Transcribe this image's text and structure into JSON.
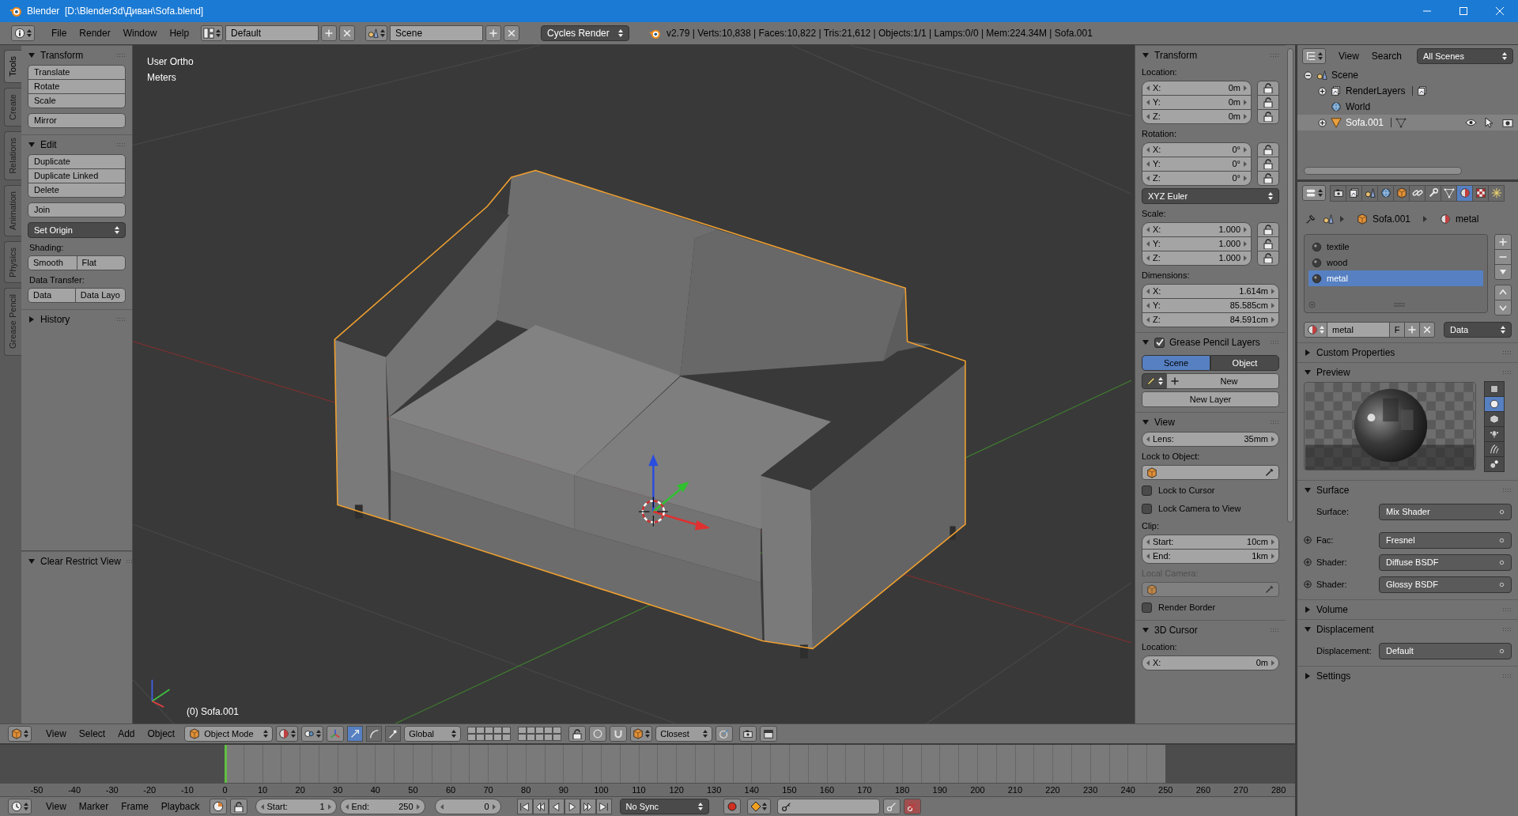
{
  "window": {
    "title": "Blender  [D:\\Blender3d\\Диван\\Sofa.blend]"
  },
  "info_header": {
    "menus": [
      "File",
      "Render",
      "Window",
      "Help"
    ],
    "layout": "Default",
    "scene": "Scene",
    "engine": "Cycles Render",
    "stats": "v2.79 | Verts:10,838 | Faces:10,822 | Tris:21,612 | Objects:1/1 | Lamps:0/0 | Mem:224.34M | Sofa.001"
  },
  "tool_tabs": [
    {
      "label": "Tools",
      "selected": true
    },
    {
      "label": "Create",
      "selected": false
    },
    {
      "label": "Relations",
      "selected": false
    },
    {
      "label": "Animation",
      "selected": false
    },
    {
      "label": "Physics",
      "selected": false
    },
    {
      "label": "Grease Pencil",
      "selected": false
    }
  ],
  "tool_shelf": [
    {
      "title": "Transform",
      "expanded": true,
      "items": [
        {
          "kind": "column",
          "labels": [
            "Translate",
            "Rotate",
            "Scale"
          ]
        },
        {
          "kind": "column",
          "labels": [
            "Mirror"
          ]
        }
      ]
    },
    {
      "title": "Edit",
      "expanded": true,
      "items": [
        {
          "kind": "column",
          "labels": [
            "Duplicate",
            "Duplicate Linked",
            "Delete"
          ]
        },
        {
          "kind": "column",
          "labels": [
            "Join"
          ]
        },
        {
          "kind": "dropdown",
          "text": "Set Origin"
        },
        {
          "kind": "label",
          "text": "Shading:"
        },
        {
          "kind": "row",
          "labels": [
            "Smooth",
            "Flat"
          ]
        },
        {
          "kind": "label",
          "text": "Data Transfer:"
        },
        {
          "kind": "row",
          "labels": [
            "Data",
            "Data Layo"
          ]
        }
      ]
    },
    {
      "title": "History",
      "expanded": false
    }
  ],
  "operator_panel": {
    "title": "Clear Restrict View",
    "expanded": true
  },
  "viewport": {
    "view_name": "User Ortho",
    "units": "Meters",
    "object_label": "(0) Sofa.001"
  },
  "properties_region": [
    {
      "title": "Transform",
      "expanded": true,
      "items": [
        {
          "kind": "label",
          "text": "Location:"
        },
        {
          "kind": "vector",
          "locks": true,
          "fields": [
            {
              "label": "X:",
              "value": "0m"
            },
            {
              "label": "Y:",
              "value": "0m"
            },
            {
              "label": "Z:",
              "value": "0m"
            }
          ]
        },
        {
          "kind": "label",
          "text": "Rotation:"
        },
        {
          "kind": "vector",
          "locks": true,
          "fields": [
            {
              "label": "X:",
              "value": "0°"
            },
            {
              "label": "Y:",
              "value": "0°"
            },
            {
              "label": "Z:",
              "value": "0°"
            }
          ]
        },
        {
          "kind": "dropdown",
          "text": "XYZ Euler"
        },
        {
          "kind": "label",
          "text": "Scale:"
        },
        {
          "kind": "vector",
          "locks": true,
          "fields": [
            {
              "label": "X:",
              "value": "1.000"
            },
            {
              "label": "Y:",
              "value": "1.000"
            },
            {
              "label": "Z:",
              "value": "1.000"
            }
          ]
        },
        {
          "kind": "label",
          "text": "Dimensions:"
        },
        {
          "kind": "vector",
          "locks": false,
          "fields": [
            {
              "label": "X:",
              "value": "1.614m"
            },
            {
              "label": "Y:",
              "value": "85.585cm"
            },
            {
              "label": "Z:",
              "value": "84.591cm"
            }
          ]
        }
      ]
    },
    {
      "title": "Grease Pencil Layers",
      "expanded": true,
      "checked": true,
      "items": [
        {
          "kind": "toggle",
          "options": [
            {
              "label": "Scene",
              "selected": true
            },
            {
              "label": "Object",
              "selected": false
            }
          ]
        },
        {
          "kind": "new",
          "text": "New"
        },
        {
          "kind": "button",
          "text": "New Layer"
        }
      ]
    },
    {
      "title": "View",
      "expanded": true,
      "items": [
        {
          "kind": "vector",
          "locks": false,
          "fields": [
            {
              "label": "Lens:",
              "value": "35mm"
            }
          ]
        },
        {
          "kind": "label",
          "text": "Lock to Object:"
        },
        {
          "kind": "object_field",
          "disabled": false
        },
        {
          "kind": "checkbox",
          "text": "Lock to Cursor",
          "checked": false
        },
        {
          "kind": "checkbox",
          "text": "Lock Camera to View",
          "checked": false
        },
        {
          "kind": "label",
          "text": "Clip:"
        },
        {
          "kind": "vector",
          "locks": false,
          "fields": [
            {
              "label": "Start:",
              "value": "10cm"
            },
            {
              "label": "End:",
              "value": "1km"
            }
          ]
        },
        {
          "kind": "label",
          "text": "Local Camera:",
          "disabled": true
        },
        {
          "kind": "object_field",
          "disabled": true
        },
        {
          "kind": "checkbox",
          "text": "Render Border",
          "checked": false
        }
      ]
    },
    {
      "title": "3D Cursor",
      "expanded": true,
      "items": [
        {
          "kind": "label",
          "text": "Location:"
        },
        {
          "kind": "vector",
          "locks": false,
          "fields": [
            {
              "label": "X:",
              "value": "0m"
            }
          ]
        }
      ]
    }
  ],
  "outliner": {
    "menus": [
      "View",
      "Search"
    ],
    "display": "All Scenes",
    "tree": [
      {
        "name": "Scene",
        "kind": "scene",
        "expanded": true,
        "selected": false,
        "children": [
          {
            "name": "RenderLayers",
            "kind": "render_layers",
            "expanded": false,
            "selected": false
          },
          {
            "name": "World",
            "kind": "world",
            "selected": false
          },
          {
            "name": "Sofa.001",
            "kind": "mesh_object",
            "expanded": false,
            "selected": true
          }
        ]
      }
    ]
  },
  "properties": {
    "context_tabs": [
      {
        "kind": "render",
        "selected": false
      },
      {
        "kind": "render_layers",
        "selected": false
      },
      {
        "kind": "scene",
        "selected": false
      },
      {
        "kind": "world",
        "selected": false
      },
      {
        "kind": "object",
        "selected": false
      },
      {
        "kind": "constraints",
        "selected": false
      },
      {
        "kind": "modifiers",
        "selected": false
      },
      {
        "kind": "data",
        "selected": false
      },
      {
        "kind": "material",
        "selected": true
      },
      {
        "kind": "texture",
        "selected": false
      },
      {
        "kind": "particles",
        "selected": false
      }
    ],
    "breadcrumb": [
      "Sofa.001",
      "metal"
    ],
    "material_slots": [
      {
        "name": "textile",
        "selected": false
      },
      {
        "name": "wood",
        "selected": false
      },
      {
        "name": "metal",
        "selected": true
      }
    ],
    "material": {
      "name": "metal",
      "fake_user": "F",
      "link": "Data"
    },
    "panels": [
      {
        "title": "Custom Properties",
        "expanded": false
      },
      {
        "title": "Preview",
        "expanded": true,
        "kind": "preview",
        "shapes": [
          {
            "kind": "plane",
            "selected": false
          },
          {
            "kind": "sphere",
            "selected": true
          },
          {
            "kind": "cube",
            "selected": false
          },
          {
            "kind": "monkey",
            "selected": false
          },
          {
            "kind": "hair",
            "selected": false
          },
          {
            "kind": "spheres",
            "selected": false
          }
        ]
      },
      {
        "title": "Surface",
        "expanded": true,
        "kind": "sockets",
        "rows": [
          {
            "label": "Surface:",
            "value": "Mix Shader",
            "linked": false
          },
          {
            "label": "Fac:",
            "value": "Fresnel",
            "linked": true
          },
          {
            "label": "Shader:",
            "value": "Diffuse BSDF",
            "linked": true
          },
          {
            "label": "Shader:",
            "value": "Glossy BSDF",
            "linked": true
          }
        ]
      },
      {
        "title": "Volume",
        "expanded": false
      },
      {
        "title": "Displacement",
        "expanded": true,
        "kind": "sockets",
        "rows": [
          {
            "label": "Displacement:",
            "value": "Default",
            "linked": false
          }
        ]
      },
      {
        "title": "Settings",
        "expanded": false
      }
    ]
  },
  "view3d_header": {
    "menus": [
      "View",
      "Select",
      "Add",
      "Object"
    ],
    "mode": "Object Mode",
    "manipulators": [
      {
        "kind": "translate",
        "selected": true
      },
      {
        "kind": "rotate",
        "selected": false
      },
      {
        "kind": "scale",
        "selected": false
      }
    ],
    "orientation": "Global",
    "snap_target": "Closest"
  },
  "timeline": {
    "ruler": [
      "-50",
      "-40",
      "-30",
      "-20",
      "-10",
      "0",
      "10",
      "20",
      "30",
      "40",
      "50",
      "60",
      "70",
      "80",
      "90",
      "100",
      "110",
      "120",
      "130",
      "140",
      "150",
      "160",
      "170",
      "180",
      "190",
      "200",
      "210",
      "220",
      "230",
      "240",
      "250",
      "260",
      "270",
      "280"
    ],
    "playhead": {
      "level": 0.1618
    },
    "menus": [
      "View",
      "Marker",
      "Frame",
      "Playback"
    ],
    "start": {
      "label": "Start:",
      "value": "1"
    },
    "end": {
      "label": "End:",
      "value": "250"
    },
    "current_frame": "0",
    "sync": "No Sync"
  }
}
